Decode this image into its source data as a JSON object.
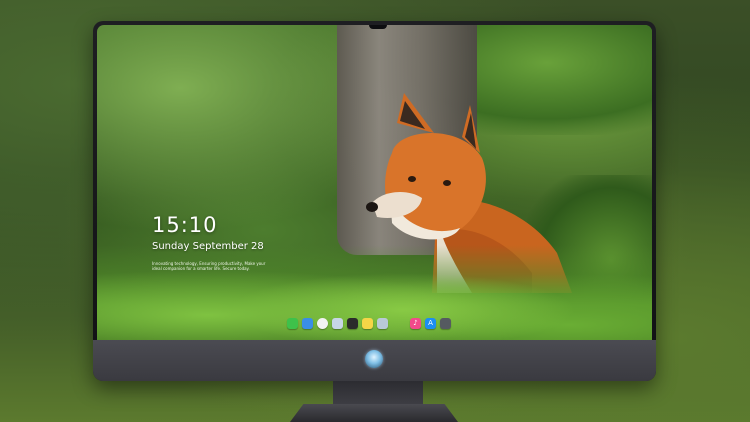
{
  "lockscreen": {
    "time": "15:10",
    "date": "Sunday September 28",
    "tagline": "Innovating technology, Ensuring productivity, Make your ideal companion for a smarter life. Secure today."
  },
  "dock": {
    "items": [
      {
        "name": "messages",
        "glyph": "",
        "color": "#3ec14a"
      },
      {
        "name": "finder",
        "glyph": "",
        "color": "#3a8ee6"
      },
      {
        "name": "clock",
        "glyph": "",
        "color": "#f2f2f2"
      },
      {
        "name": "photos",
        "glyph": "",
        "color": "#c7d6e6"
      },
      {
        "name": "clapper",
        "glyph": "",
        "color": "#2b2b2b"
      },
      {
        "name": "notes",
        "glyph": "",
        "color": "#f5d547"
      },
      {
        "name": "preview",
        "glyph": "",
        "color": "#b9c9d8"
      },
      {
        "name": "music",
        "glyph": "♪",
        "color": "#f24a8b"
      },
      {
        "name": "app-store",
        "glyph": "A",
        "color": "#1c8ef2"
      },
      {
        "name": "camera",
        "glyph": "",
        "color": "#555a60"
      }
    ]
  },
  "colors": {
    "accent": "#1c8ef2",
    "fox_orange": "#d9742a"
  }
}
